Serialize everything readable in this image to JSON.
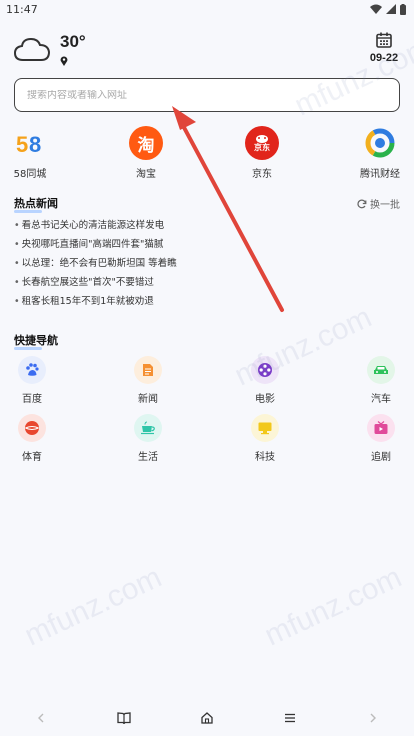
{
  "status_bar": {
    "time": "11:47"
  },
  "weather": {
    "temperature": "30°",
    "date": "09-22"
  },
  "search": {
    "placeholder": "搜索内容或者输入网址"
  },
  "shortcuts": [
    {
      "label": "58同城",
      "logo_text": "58"
    },
    {
      "label": "淘宝",
      "logo_text": "淘"
    },
    {
      "label": "京东",
      "logo_text": "京东"
    },
    {
      "label": "腾讯财经",
      "logo_text": ""
    }
  ],
  "hot_news": {
    "title": "热点新闻",
    "refresh_label": "换一批",
    "items": [
      "看总书记关心的清洁能源这样发电",
      "央视哪吒直播间\"高端四件套\"猫腻",
      "以总理：绝不会有巴勒斯坦国 等着瞧",
      "长春航空展这些\"首次\"不要错过",
      "租客长租15年不到1年就被劝退"
    ]
  },
  "quick_nav": {
    "title": "快捷导航",
    "items": [
      {
        "label": "百度",
        "color": "#3b6cf0",
        "icon": "paw-icon"
      },
      {
        "label": "新闻",
        "color": "#f59032",
        "icon": "document-icon"
      },
      {
        "label": "电影",
        "color": "#7a3cc8",
        "icon": "film-reel-icon"
      },
      {
        "label": "汽车",
        "color": "#2ec25b",
        "icon": "car-icon"
      },
      {
        "label": "体育",
        "color": "#e8472f",
        "icon": "ball-icon"
      },
      {
        "label": "生活",
        "color": "#2fc5a8",
        "icon": "cup-icon"
      },
      {
        "label": "科技",
        "color": "#f2c81a",
        "icon": "monitor-icon"
      },
      {
        "label": "追剧",
        "color": "#e04a9a",
        "icon": "tv-icon"
      }
    ]
  },
  "watermark": {
    "text": "mfunz.com"
  },
  "colors": {
    "arrow": "#e0453a",
    "search_border": "#444444"
  }
}
